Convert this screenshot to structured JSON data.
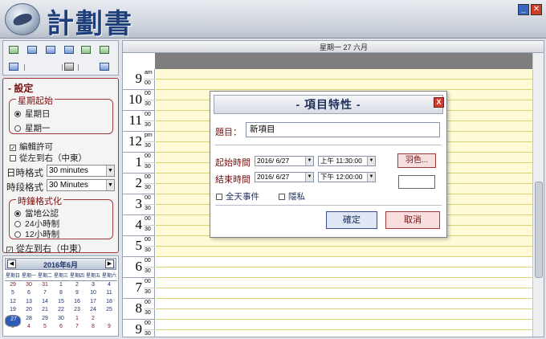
{
  "app": {
    "title": "計劃書"
  },
  "window": {
    "minimize_glyph": "_",
    "close_glyph": "✕"
  },
  "settings": {
    "heading": "設定",
    "week_start": {
      "legend": "星期起始",
      "options": [
        "星期日",
        "星期一"
      ],
      "selected": "星期日"
    },
    "checkboxes": {
      "editable": "編輯許可",
      "rtl": "從左到右（中東）"
    },
    "date_format": {
      "label": "日時格式",
      "value": "30 minutes"
    },
    "slot_format": {
      "label": "時段格式",
      "value": "30 Minutes"
    },
    "time_format": {
      "legend": "時鐘格式化",
      "options": [
        "當地公認",
        "24小時制",
        "12小時制"
      ],
      "selected": "當地公認"
    },
    "rtl_bottom": "從左到右（中東）"
  },
  "mini_calendar": {
    "title": "2016年6月",
    "prev": "◀",
    "next": "▶",
    "weekdays": [
      "星期日",
      "星期一",
      "星期二",
      "星期三",
      "星期四",
      "星期五",
      "星期六"
    ],
    "weeks": [
      [
        "29",
        "30",
        "31",
        "1",
        "2",
        "3",
        "4"
      ],
      [
        "5",
        "6",
        "7",
        "8",
        "9",
        "10",
        "11"
      ],
      [
        "12",
        "13",
        "14",
        "15",
        "16",
        "17",
        "18"
      ],
      [
        "19",
        "20",
        "21",
        "22",
        "23",
        "24",
        "25"
      ],
      [
        "26",
        "27",
        "28",
        "29",
        "30",
        "1",
        "2"
      ],
      [
        "3",
        "4",
        "5",
        "6",
        "7",
        "8",
        "9"
      ]
    ],
    "selected": "27"
  },
  "day_view": {
    "header": "星期一 27 六月",
    "hours": [
      {
        "hour": "9",
        "top": "am",
        "bottom": "00"
      },
      {
        "hour": "10",
        "top": "00",
        "bottom": "30"
      },
      {
        "hour": "11",
        "top": "00",
        "bottom": "30"
      },
      {
        "hour": "12",
        "top": "pm",
        "bottom": "30"
      },
      {
        "hour": "1",
        "top": "00",
        "bottom": "30"
      },
      {
        "hour": "2",
        "top": "00",
        "bottom": "30"
      },
      {
        "hour": "3",
        "top": "00",
        "bottom": "30"
      },
      {
        "hour": "4",
        "top": "00",
        "bottom": "30"
      },
      {
        "hour": "5",
        "top": "00",
        "bottom": "30"
      },
      {
        "hour": "6",
        "top": "00",
        "bottom": "30"
      },
      {
        "hour": "7",
        "top": "00",
        "bottom": "30"
      },
      {
        "hour": "8",
        "top": "00",
        "bottom": "30"
      },
      {
        "hour": "9",
        "top": "00",
        "bottom": "30"
      }
    ]
  },
  "dialog": {
    "title": "- 項目特性 -",
    "close": "X",
    "subject_label": "題目：",
    "subject_value": "新項目",
    "start_label": "起始時間",
    "start_date": "2016/ 6/27",
    "start_time": "上午 11:30:00",
    "end_label": "結束時間",
    "end_date": "2016/ 6/27",
    "end_time": "下午 12:00:00",
    "color_button": "羽色...",
    "all_day": "全天事件",
    "private": "隱私",
    "ok": "確定",
    "cancel": "取消",
    "colors": {
      "accent": "#a33a3a",
      "primary": "#1d2f5a"
    }
  }
}
